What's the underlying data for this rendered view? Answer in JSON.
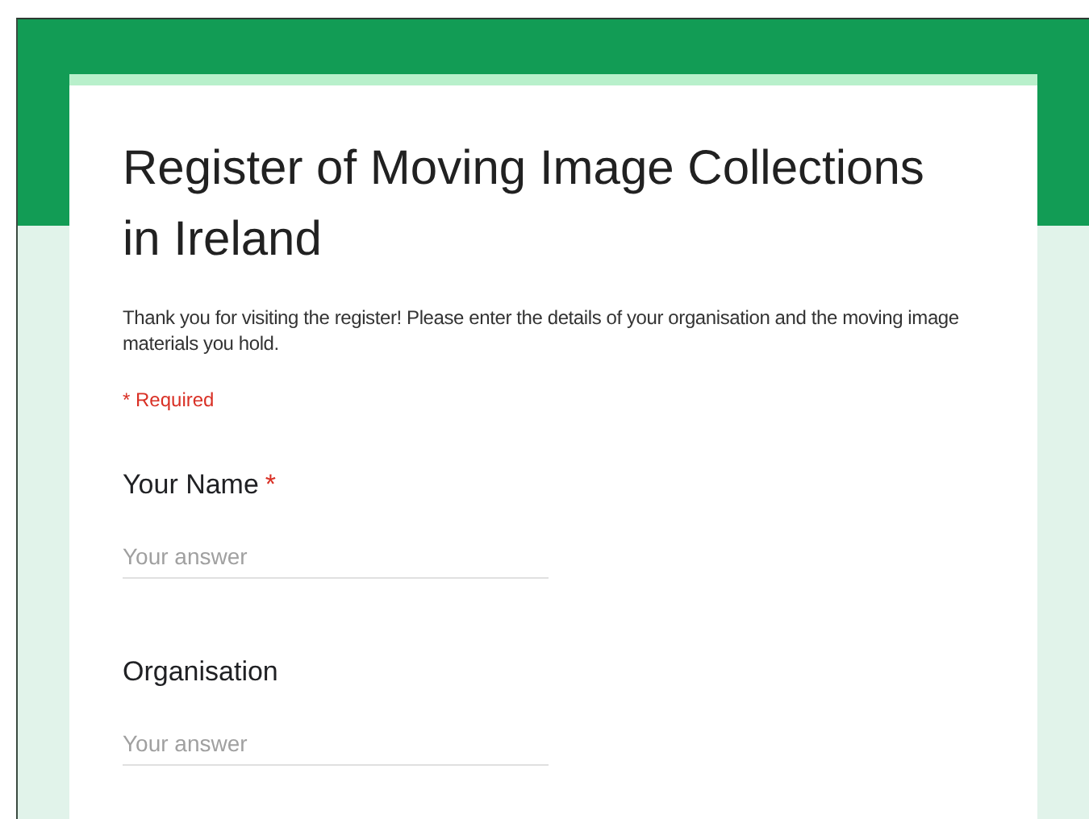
{
  "form": {
    "title": "Register of Moving Image Collections in Ireland",
    "description": "Thank you for visiting the register! Please enter the details of your organisation and the moving image materials you hold.",
    "required_note": "* Required",
    "required_marker": "*"
  },
  "questions": [
    {
      "label": "Your Name",
      "required": true,
      "placeholder": "Your answer"
    },
    {
      "label": "Organisation",
      "required": false,
      "placeholder": "Your answer"
    }
  ]
}
